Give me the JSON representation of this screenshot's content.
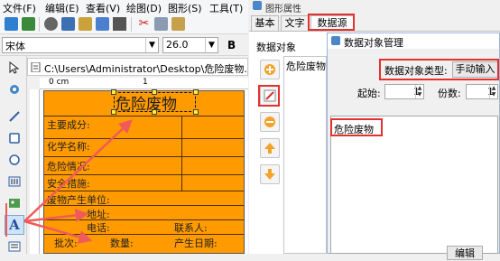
{
  "menu": [
    "文件(F)",
    "编辑(E)",
    "查看(V)",
    "绘图(D)",
    "图形(S)",
    "工具(T)"
  ],
  "font": {
    "family": "宋体",
    "size": "26.0",
    "bold_label": "B"
  },
  "document": {
    "path": "C:\\Users\\Administrator\\Desktop\\危险废物.zhl *",
    "ruler_zero": "0 cm",
    "ruler_one": "1"
  },
  "label": {
    "title": "危险废物",
    "fields": [
      "主要成分:",
      "化学名称:",
      "危险情况:",
      "安全措施:",
      "废物产生单位:",
      "地址:",
      "电话:",
      "联系人:",
      "批次:",
      "数量:",
      "产生日期:"
    ]
  },
  "panel": {
    "title": "图形属性",
    "tabs": [
      "基本",
      "文字",
      "数据源"
    ],
    "data_objects_label": "数据对象",
    "list": [
      "危险废物"
    ]
  },
  "dialog": {
    "title": "数据对象管理",
    "type_label": "数据对象类型:",
    "type_button": "手动输入",
    "start_label": "起始:",
    "start_value": "1",
    "count_label": "份数:",
    "count_value": "1",
    "content": "危险废物",
    "bottom_button": "编辑"
  },
  "colors": {
    "label_bg": "#ff9a00",
    "highlight": "#e53030",
    "arrow": "#f05a5a"
  }
}
